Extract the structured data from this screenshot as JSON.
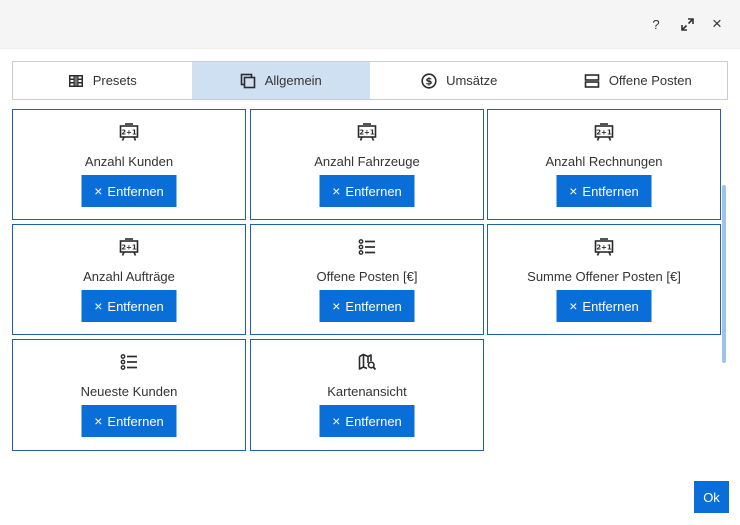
{
  "header": {
    "help_label": "?",
    "close_label": "×"
  },
  "tabs": [
    {
      "label": "Presets",
      "icon": "presets-icon"
    },
    {
      "label": "Allgemein",
      "icon": "copy-icon",
      "active": true
    },
    {
      "label": "Umsätze",
      "icon": "dollar-circle-icon"
    },
    {
      "label": "Offene Posten",
      "icon": "stack-icon"
    }
  ],
  "cards": [
    {
      "title": "Anzahl Kunden",
      "icon": "counter-icon"
    },
    {
      "title": "Anzahl Fahrzeuge",
      "icon": "counter-icon"
    },
    {
      "title": "Anzahl Rechnungen",
      "icon": "counter-icon"
    },
    {
      "title": "Anzahl Aufträge",
      "icon": "counter-icon"
    },
    {
      "title": "Offene Posten [€]",
      "icon": "list-icon"
    },
    {
      "title": "Summe Offener Posten [€]",
      "icon": "counter-icon"
    },
    {
      "title": "Neueste Kunden",
      "icon": "list-icon"
    },
    {
      "title": "Kartenansicht",
      "icon": "map-search-icon"
    }
  ],
  "remove_label": "Entfernen",
  "remove_icon": "×",
  "ok_label": "Ok",
  "colors": {
    "primary": "#0a6ed8",
    "card_border": "#1f5fae",
    "active_tab": "#cfe0f3"
  }
}
